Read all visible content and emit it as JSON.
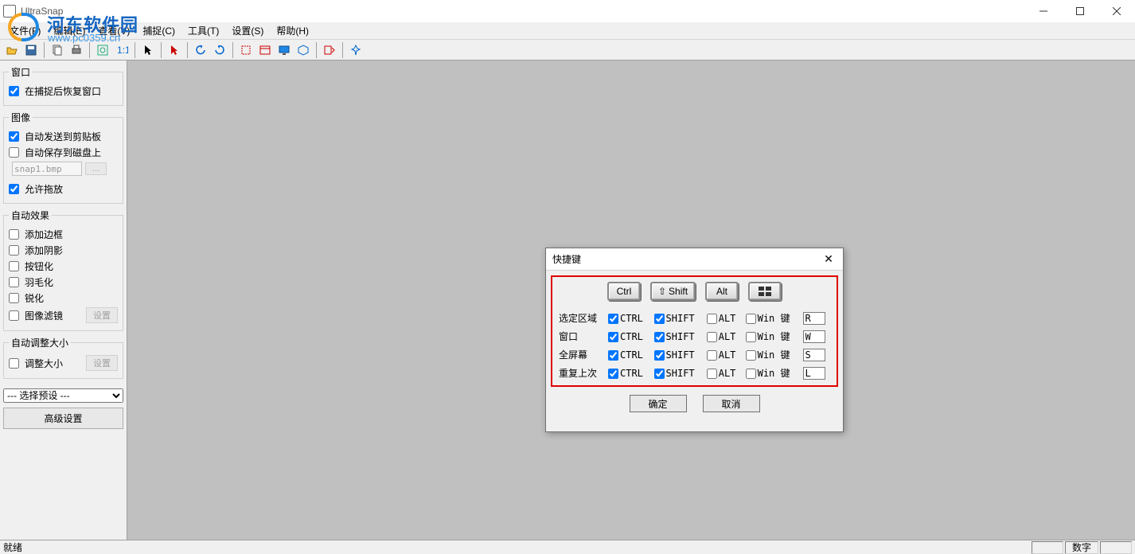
{
  "app_title": "UltraSnap",
  "watermark": {
    "text": "河东软件园",
    "url": "www.pc0359.cn"
  },
  "menus": [
    "文件(F)",
    "编辑(E)",
    "查看(V)",
    "捕捉(C)",
    "工具(T)",
    "设置(S)",
    "帮助(H)"
  ],
  "sidebar": {
    "window_group": {
      "legend": "窗口",
      "restore": "在捕捉后恢复窗口"
    },
    "image_group": {
      "legend": "图像",
      "auto_clip": "自动发送到剪贴板",
      "auto_save": "自动保存到磁盘上",
      "filename": "snap1.bmp",
      "browse": "...",
      "allow_drag": "允许拖放"
    },
    "effects_group": {
      "legend": "自动效果",
      "items": [
        "添加边框",
        "添加阴影",
        "按钮化",
        "羽毛化",
        "锐化"
      ],
      "filter": "图像滤镜",
      "settings": "设置"
    },
    "resize_group": {
      "legend": "自动调整大小",
      "resize": "调整大小",
      "settings": "设置"
    },
    "preset_placeholder": "--- 选择预设 ---",
    "advanced": "高级设置"
  },
  "dialog": {
    "title": "快捷键",
    "keycaps": [
      "Ctrl",
      "Shift",
      "Alt"
    ],
    "columns": {
      "ctrl": "CTRL",
      "shift": "SHIFT",
      "alt": "ALT",
      "win": "Win 键"
    },
    "rows": [
      {
        "label": "选定区域",
        "ctrl": true,
        "shift": true,
        "alt": false,
        "win": false,
        "key": "R"
      },
      {
        "label": "窗口",
        "ctrl": true,
        "shift": true,
        "alt": false,
        "win": false,
        "key": "W"
      },
      {
        "label": "全屏幕",
        "ctrl": true,
        "shift": true,
        "alt": false,
        "win": false,
        "key": "S"
      },
      {
        "label": "重复上次",
        "ctrl": true,
        "shift": true,
        "alt": false,
        "win": false,
        "key": "L"
      }
    ],
    "ok": "确定",
    "cancel": "取消"
  },
  "statusbar": {
    "ready": "就绪",
    "numlock": "数字"
  }
}
